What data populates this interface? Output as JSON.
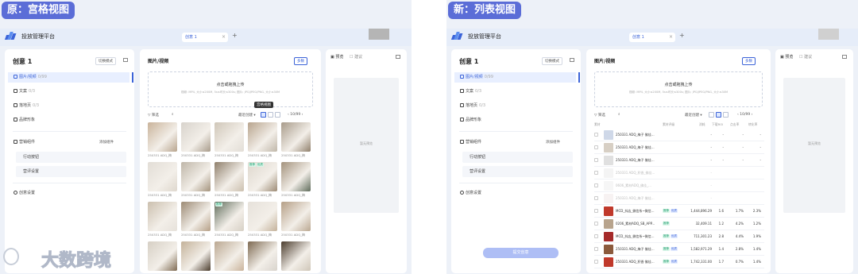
{
  "colors": {
    "accent": "#3b63d8",
    "pill_bg": "#5b6dd7",
    "panel_bg": "#edf1f8"
  },
  "icons": [
    "app-logo",
    "image-icon",
    "document-icon",
    "landing-icon",
    "brand-icon",
    "marketing-icon",
    "settings-icon",
    "filter-icon",
    "search-icon",
    "grid-view-icon",
    "list-view-icon",
    "collapse-icon"
  ],
  "left": {
    "label": "原：宫格视图",
    "app_title": "投放管理平台",
    "tab_label": "创意 1",
    "tab_close": "×",
    "tab_add": "+",
    "creative_title": "创意 1",
    "switch_mode_label": "切换模式",
    "menu": [
      {
        "label": "图片/视频",
        "count": "0/99"
      },
      {
        "label": "文案",
        "count": "0/3"
      },
      {
        "label": "落地页",
        "count": "0/3"
      },
      {
        "label": "品牌形象",
        "count": ""
      }
    ],
    "marketing": {
      "label": "营销组件",
      "add_label": "添加组件",
      "items": [
        "行动按钮",
        "营评设置"
      ]
    },
    "creative_settings": "创意设置",
    "media_title": "图片/视频",
    "multi_select": "多数",
    "upload_title": "点击或拖拽上传",
    "upload_hint": "视频: MP4, 大小≤200M, 5s≤时长≤300s; 图片: JPG/JPEG/PNG, 大小≤30M",
    "filter_label": "筛选",
    "sort_label": "最近创建",
    "pager": "10/99",
    "tooltip": "宫格视图",
    "preview_tab": "预览",
    "preview_tab2": "建议",
    "preview_empty": "暂无预览",
    "thumbs": [
      {
        "caption": "250331 ADQ_梅",
        "badges": []
      },
      {
        "caption": "250331 ADQ_梅",
        "badges": []
      },
      {
        "caption": "250331 ADQ_梅",
        "badges": []
      },
      {
        "caption": "250331 ADQ_梅",
        "badges": []
      },
      {
        "caption": "250331 ADQ_梅",
        "badges": []
      },
      {
        "caption": "250331 ADQ_梅",
        "badges": []
      },
      {
        "caption": "250331 ADQ_梅",
        "badges": []
      },
      {
        "caption": "250331 ADQ_梅",
        "badges": []
      },
      {
        "caption": "250331 ADQ_梅",
        "badges": [
          "推荐",
          "优质"
        ]
      },
      {
        "caption": "250331 ADQ_梅",
        "badges": []
      },
      {
        "caption": "250331 ADQ_梅",
        "badges": []
      },
      {
        "caption": "250331 ADQ_梅",
        "badges": []
      },
      {
        "caption": "250331 ADQ_梅",
        "badges": [
          "推荐"
        ]
      },
      {
        "caption": "250331 ADQ_梅",
        "badges": []
      },
      {
        "caption": "250331 ADQ_梅",
        "badges": []
      },
      {
        "caption": "",
        "badges": []
      },
      {
        "caption": "",
        "badges": []
      },
      {
        "caption": "",
        "badges": []
      },
      {
        "caption": "",
        "badges": []
      },
      {
        "caption": "",
        "badges": []
      }
    ],
    "watermark": "大数跨境"
  },
  "right": {
    "label": "新：列表视图",
    "app_title": "投放管理平台",
    "tab_label": "创意 1",
    "tab_close": "×",
    "tab_add": "+",
    "creative_title": "创意 1",
    "switch_mode_label": "切换模式",
    "menu": [
      {
        "label": "图片/视频",
        "count": "0/99"
      },
      {
        "label": "文案",
        "count": "0/3"
      },
      {
        "label": "落地页",
        "count": "0/3"
      },
      {
        "label": "品牌形象",
        "count": ""
      }
    ],
    "marketing": {
      "label": "营销组件",
      "add_label": "添加组件",
      "items": [
        "行动按钮",
        "营评设置"
      ]
    },
    "creative_settings": "创意设置",
    "submit_label": "提交创意",
    "media_title": "图片/视频",
    "multi_select": "多数",
    "upload_title": "点击或拖拽上传",
    "upload_hint": "视频: MP4, 大小≤200M, 5s≤时长≤300s; 图片: JPG/JPEG/PNG, 大小≤30M",
    "filter_label": "筛选",
    "sort_label": "最近创建",
    "pager": "10/99",
    "preview_tab": "预览",
    "preview_tab2": "建议",
    "preview_empty": "暂无预览",
    "table_headers": [
      "素材",
      "素材评级",
      "消耗",
      "下载ROI",
      "点击率",
      "转化率"
    ],
    "rows": [
      {
        "name": "250331 ADQ_梅子 佛佳...",
        "badges": [],
        "spend": "-",
        "roi": "-",
        "ctr": "-",
        "cvr": "-",
        "muted": false
      },
      {
        "name": "250331 ADQ_梅子 佛佳...",
        "badges": [],
        "spend": "-",
        "roi": "-",
        "ctr": "-",
        "cvr": "-",
        "muted": false
      },
      {
        "name": "250331 ADQ_梅子 佛佳...",
        "badges": [],
        "spend": "-",
        "roi": "-",
        "ctr": "-",
        "cvr": "-",
        "muted": false
      },
      {
        "name": "250331 ADQ_积香_佛佳...",
        "badges": [],
        "spend": "-",
        "roi": "",
        "ctr": "",
        "cvr": "",
        "muted": true
      },
      {
        "name": "0606_素材ADQ_佛佳_...",
        "badges": [],
        "spend": "-",
        "roi": "",
        "ctr": "",
        "cvr": "",
        "muted": true
      },
      {
        "name": "250331 ADQ_梅子 佛佳...",
        "badges": [],
        "spend": "-",
        "roi": "",
        "ctr": "",
        "cvr": "",
        "muted": true
      },
      {
        "name": "MCD_抖店_微信系~微信...",
        "badges": [
          "推荐",
          "优质"
        ],
        "spend": "1,444,896.29",
        "roi": "1.6",
        "ctr": "1.7%",
        "cvr": "2.3%",
        "muted": false
      },
      {
        "name": "0206_素材ADQ_SB_APP...",
        "badges": [
          "推荐"
        ],
        "spend": "32,409.11",
        "roi": "1.2",
        "ctr": "4.2%",
        "cvr": "1.2%",
        "muted": false
      },
      {
        "name": "MCD_抖店_微信系~微信...",
        "badges": [
          "推荐",
          "优质"
        ],
        "spend": "711,301.23",
        "roi": "2.8",
        "ctr": "4.4%",
        "cvr": "1.9%",
        "muted": false
      },
      {
        "name": "250331 ADQ_梅子 佛佳...",
        "badges": [
          "推荐",
          "优质"
        ],
        "spend": "1,582,971.29",
        "roi": "1.4",
        "ctr": "2.8%",
        "cvr": "1.4%",
        "muted": false
      },
      {
        "name": "250331 ADQ_积香 佛佳...",
        "badges": [
          "推荐",
          "优质"
        ],
        "spend": "1,742,331.00",
        "roi": "1.7",
        "ctr": "0.7%",
        "cvr": "1.4%",
        "muted": false
      }
    ]
  }
}
